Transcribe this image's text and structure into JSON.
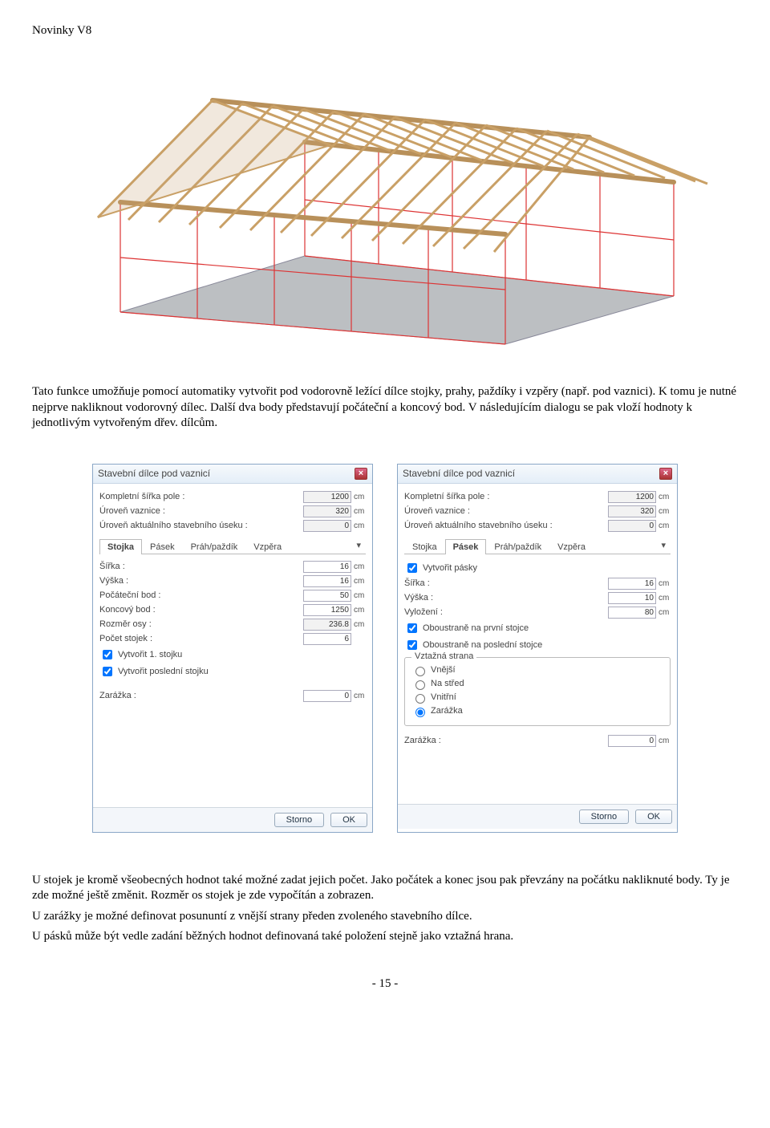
{
  "header": "Novinky V8",
  "p1": "Tato funkce umožňuje pomocí automatiky vytvořit pod vodorovně ležící dílce stojky, prahy, paždíky i vzpěry (např. pod vaznici). K tomu je nutné nejprve nakliknout vodorovný dílec. Další dva body představují počáteční a koncový bod. V následujícím dialogu se pak vloží hodnoty k jednotlivým vytvořeným dřev. dílcům.",
  "p2": "U stojek je kromě všeobecných hodnot také možné zadat jejich počet. Jako počátek a konec jsou pak převzány na počátku nakliknuté body. Ty je zde možné ještě změnit. Rozměr os stojek je zde vypočítán a zobrazen.",
  "p3": "U zarážky je možné definovat posununtí z vnější strany předen zvoleného stavebního dílce.",
  "p4": "U pásků může být vedle zadání běžných hodnot definovaná také položení stejně jako vztažná hrana.",
  "pagenum": "- 15 -",
  "dialog": {
    "title": "Stavební dílce pod vaznicí",
    "header_fields": {
      "f1_label": "Kompletní šířka pole :",
      "f1_value": "1200",
      "f2_label": "Úroveň vaznice :",
      "f2_value": "320",
      "f3_label": "Úroveň aktuálního stavebního úseku :",
      "f3_value": "0",
      "unit": "cm"
    },
    "tabs": [
      "Stojka",
      "Pásek",
      "Práh/paždík",
      "Vzpěra"
    ],
    "footer": {
      "cancel": "Storno",
      "ok": "OK"
    }
  },
  "left": {
    "active_tab": "Stojka",
    "fields": {
      "sirka_l": "Šířka :",
      "sirka_v": "16",
      "vyska_l": "Výška :",
      "vyska_v": "16",
      "pocatecni_l": "Počáteční bod :",
      "pocatecni_v": "50",
      "koncovy_l": "Koncový bod :",
      "koncovy_v": "1250",
      "rozmer_l": "Rozměr osy :",
      "rozmer_v": "236.8",
      "pocet_l": "Počet stojek :",
      "pocet_v": "6",
      "unit": "cm"
    },
    "chk1": "Vytvořit 1. stojku",
    "chk2": "Vytvořit poslední stojku",
    "zarazka_l": "Zarážka :",
    "zarazka_v": "0"
  },
  "right": {
    "active_tab": "Pásek",
    "chk_create": "Vytvořit pásky",
    "fields": {
      "sirka_l": "Šířka :",
      "sirka_v": "16",
      "vyska_l": "Výška :",
      "vyska_v": "10",
      "vylozeni_l": "Vyložení :",
      "vylozeni_v": "80",
      "unit": "cm"
    },
    "chk_first": "Oboustraně na první stojce",
    "chk_last": "Oboustraně na poslední stojce",
    "group_title": "Vztažná strana",
    "radios": {
      "r1": "Vnější",
      "r2": "Na střed",
      "r3": "Vnitřní",
      "r4": "Zarážka"
    },
    "zarazka_l": "Zarážka :",
    "zarazka_v": "0"
  }
}
